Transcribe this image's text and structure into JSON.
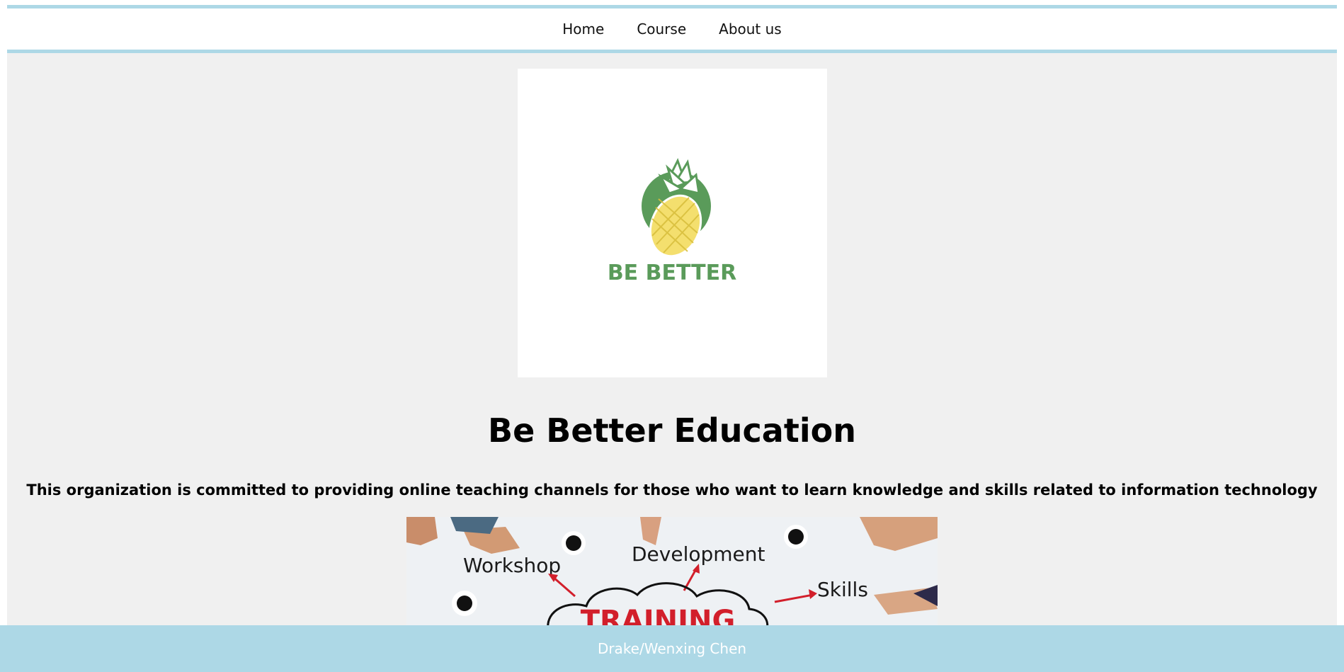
{
  "nav": {
    "items": [
      {
        "label": "Home"
      },
      {
        "label": "Course"
      },
      {
        "label": "About us"
      }
    ]
  },
  "logo": {
    "brand_text": "BE BETTER",
    "icon": "pineapple-logo-icon"
  },
  "main": {
    "title": "Be Better Education",
    "subtitle": "This organization is committed to providing online teaching channels for those who want to learn knowledge and skills related to information technology"
  },
  "banner": {
    "words": [
      "Workshop",
      "Development",
      "Skills",
      "TRAINING"
    ]
  },
  "footer": {
    "text": "Drake/Wenxing Chen"
  },
  "colors": {
    "accent": "#add8e6",
    "page_bg": "#f0f0f0",
    "logo_green": "#5a9b5a",
    "logo_yellow": "#f4df6e",
    "training_red": "#d21f2b"
  }
}
